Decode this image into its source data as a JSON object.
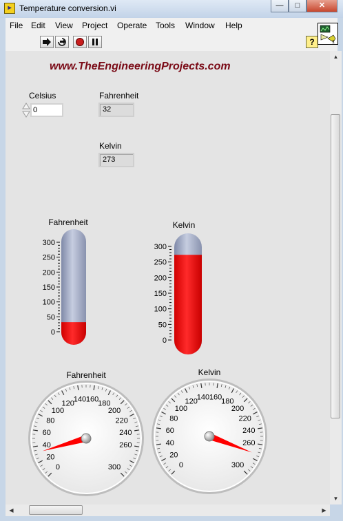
{
  "window": {
    "title": "Temperature conversion.vi",
    "app_icon": "labview-vi-icon",
    "controls": {
      "minimize": "—",
      "maximize": "□",
      "close": "✕"
    }
  },
  "menu": [
    "File",
    "Edit",
    "View",
    "Project",
    "Operate",
    "Tools",
    "Window",
    "Help"
  ],
  "toolbar": {
    "buttons": [
      "run-arrow-icon",
      "run-continuously-icon",
      "abort-icon",
      "pause-icon"
    ],
    "help": "?"
  },
  "vi_icon_number": "1",
  "panel": {
    "website": "www.TheEngineeringProjects.com",
    "celsius": {
      "label": "Celsius",
      "value": "0"
    },
    "fahrenheit": {
      "label": "Fahrenheit",
      "value": "32"
    },
    "kelvin": {
      "label": "Kelvin",
      "value": "273"
    },
    "thermometer_fahrenheit": {
      "label": "Fahrenheit",
      "value": 32,
      "scale": [
        "300",
        "250",
        "200",
        "150",
        "100",
        "50",
        "0"
      ]
    },
    "thermometer_kelvin": {
      "label": "Kelvin",
      "value": 273,
      "scale": [
        "300",
        "250",
        "200",
        "150",
        "100",
        "50",
        "0"
      ]
    },
    "gauge_fahrenheit": {
      "label": "Fahrenheit",
      "value": 32,
      "min": 0,
      "max": 300,
      "ticks": [
        "0",
        "20",
        "40",
        "60",
        "80",
        "100",
        "120",
        "140",
        "160",
        "180",
        "200",
        "220",
        "240",
        "260",
        "300"
      ]
    },
    "gauge_kelvin": {
      "label": "Kelvin",
      "value": 273,
      "min": 0,
      "max": 300,
      "ticks": [
        "0",
        "20",
        "40",
        "60",
        "80",
        "100",
        "120",
        "140",
        "160",
        "180",
        "200",
        "220",
        "240",
        "260",
        "300"
      ]
    },
    "colors": {
      "fill": "#ff0000",
      "empty_tube": "#a9b3cd",
      "website": "#7a0a16"
    }
  }
}
